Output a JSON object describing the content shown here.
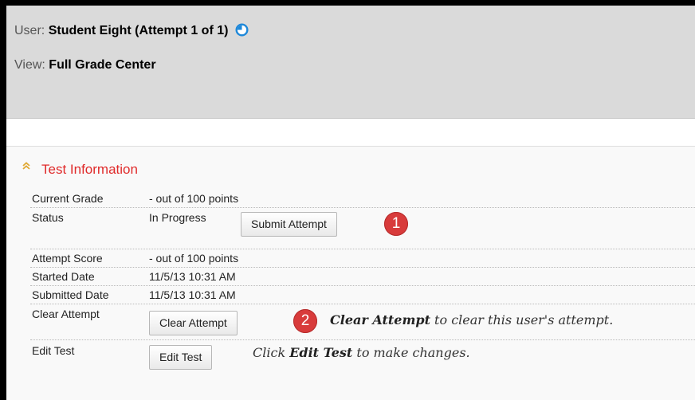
{
  "header": {
    "user_label": "User:",
    "user_value": "Student Eight (Attempt 1 of 1)",
    "view_label": "View:",
    "view_value": "Full Grade Center",
    "status_icon": "clock-icon"
  },
  "section": {
    "title": "Test Information",
    "collapse_icon": "double-caret-up-icon"
  },
  "rows": {
    "current_grade": {
      "label": "Current Grade",
      "value": "- out of 100 points"
    },
    "status": {
      "label": "Status",
      "value": "In Progress",
      "button": "Submit Attempt",
      "badge": "1"
    },
    "attempt_score": {
      "label": "Attempt Score",
      "value": "- out of 100 points"
    },
    "started_date": {
      "label": "Started Date",
      "value": "11/5/13 10:31 AM"
    },
    "submitted_date": {
      "label": "Submitted Date",
      "value": "11/5/13 10:31 AM"
    },
    "clear_attempt": {
      "label": "Clear Attempt",
      "button": "Clear Attempt",
      "badge": "2",
      "note_bold": "Clear Attempt",
      "note_rest": " to clear this user's attempt."
    },
    "edit_test": {
      "label": "Edit Test",
      "button": "Edit Test",
      "note_pre": "Click ",
      "note_bold": "Edit Test",
      "note_rest": " to make changes."
    }
  },
  "colors": {
    "accent_red": "#e02b2b",
    "badge_red": "#d83b3b",
    "header_gray": "#dadada",
    "icon_blue": "#1e88d9"
  }
}
